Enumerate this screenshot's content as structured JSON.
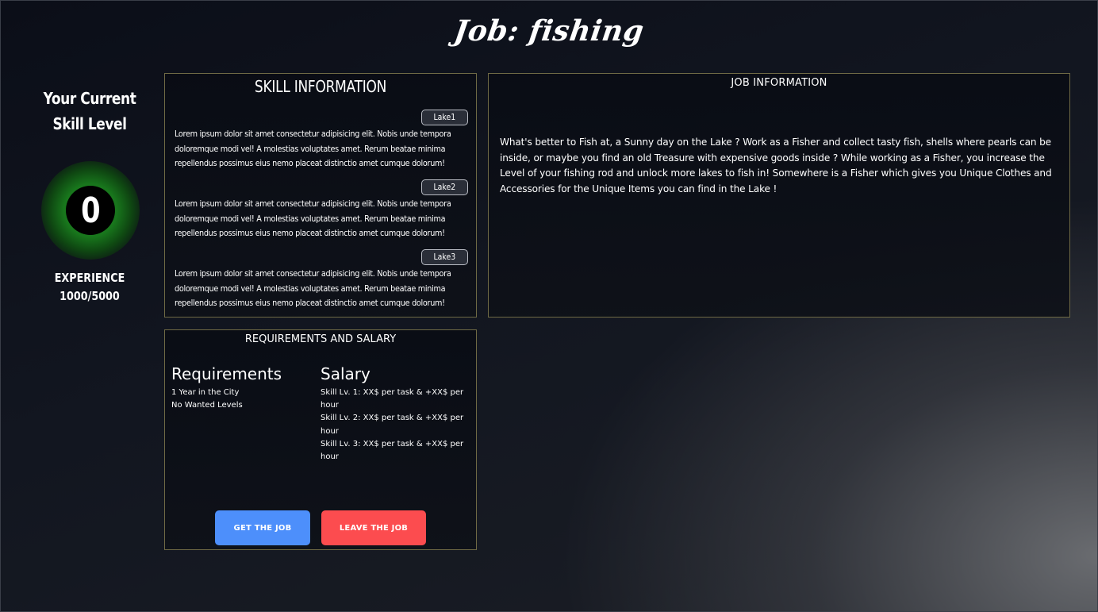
{
  "page": {
    "title": "Job: fishing"
  },
  "skill_level": {
    "title_line1": "Your Current",
    "title_line2": "Skill Level",
    "level": "0",
    "experience_label": "EXPERIENCE",
    "experience_value": "1000/5000",
    "orb_color": "#1a8a1f"
  },
  "skill_info": {
    "header": "SKILL INFORMATION",
    "lakes": [
      {
        "tag": "Lake1",
        "text": "Lorem ipsum dolor sit amet consectetur adipisicing elit. Nobis unde tempora doloremque modi vel! A molestias voluptates amet. Rerum beatae minima repellendus possimus eius nemo placeat distinctio amet cumque dolorum!"
      },
      {
        "tag": "Lake2",
        "text": "Lorem ipsum dolor sit amet consectetur adipisicing elit. Nobis unde tempora doloremque modi vel! A molestias voluptates amet. Rerum beatae minima repellendus possimus eius nemo placeat distinctio amet cumque dolorum!"
      },
      {
        "tag": "Lake3",
        "text": "Lorem ipsum dolor sit amet consectetur adipisicing elit. Nobis unde tempora doloremque modi vel! A molestias voluptates amet. Rerum beatae minima repellendus possimus eius nemo placeat distinctio amet cumque dolorum!"
      }
    ]
  },
  "job_info": {
    "header": "JOB INFORMATION",
    "text": "What's better to Fish at, a Sunny day on the Lake ? Work as a Fisher and collect tasty fish, shells where pearls can be inside, or maybe you find an old Treasure with expensive goods inside ? While working as a Fisher, you increase the Level of your fishing rod and unlock more lakes to fish in! Somewhere is a Fisher which gives you Unique Clothes and Accessories for the Unique Items you can find in the Lake !"
  },
  "requirements_salary": {
    "header": "REQUIREMENTS AND SALARY",
    "requirements_title": "Requirements",
    "requirements": [
      "1 Year in the City",
      "No Wanted Levels"
    ],
    "salary_title": "Salary",
    "salary": [
      "Skill Lv. 1: XX$ per task & +XX$ per hour",
      "Skill Lv. 2: XX$ per task & +XX$ per hour",
      "Skill Lv. 3: XX$ per task & +XX$ per hour"
    ],
    "get_job_label": "GET THE JOB",
    "leave_job_label": "LEAVE THE JOB",
    "get_job_color": "#4d8ffb",
    "leave_job_color": "#fc4c4f"
  },
  "colors": {
    "panel_border": "#6f6a45",
    "background_dark": "#0b0e18"
  }
}
